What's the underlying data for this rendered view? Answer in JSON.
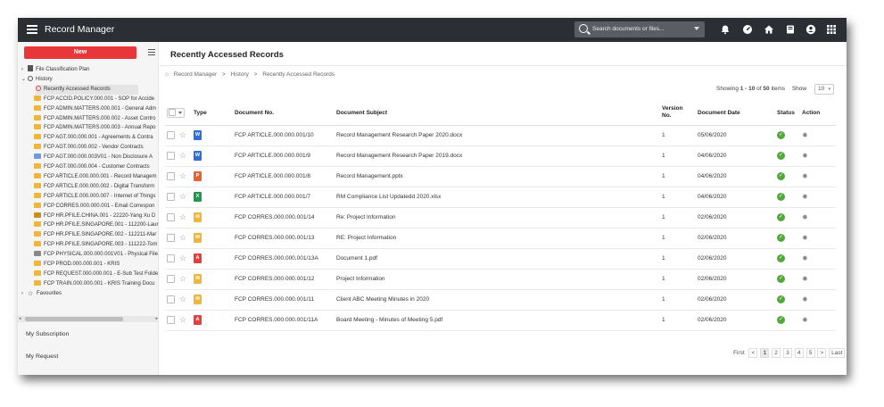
{
  "app": {
    "title": "Record Manager"
  },
  "search": {
    "placeholder": "Search documents or files..."
  },
  "topbar_icons": [
    "bell-icon",
    "dashboard-icon",
    "home-icon",
    "inbox-icon",
    "user-icon",
    "apps-grid-icon"
  ],
  "sidebar": {
    "new_label": "New",
    "tree": [
      {
        "label": "File Classification Plan",
        "icon": "cabinet",
        "caret": "›",
        "indent": 0
      },
      {
        "label": "History",
        "icon": "history",
        "caret": "⌄",
        "indent": 0
      },
      {
        "label": "Recently Accessed Records",
        "icon": "clock",
        "caret": "",
        "indent": 1,
        "selected": true
      },
      {
        "label": "FCP ACCID.POLICY.000.001 - SOP for Accide",
        "icon": "folder",
        "indent": 2
      },
      {
        "label": "FCP ADMIN.MATTERS.000.001 - General Adm",
        "icon": "folder",
        "indent": 2
      },
      {
        "label": "FCP ADMIN.MATTERS.000.002 - Asset Contro",
        "icon": "folder",
        "indent": 2
      },
      {
        "label": "FCP ADMIN.MATTERS.000.003 - Annual Repo",
        "icon": "folder",
        "indent": 2
      },
      {
        "label": "FCP AGT.000.000.001 - Agreements & Contra",
        "icon": "folder",
        "indent": 2
      },
      {
        "label": "FCP AGT.000.000.002 - Vendor Contracts",
        "icon": "folder",
        "indent": 2
      },
      {
        "label": "FCP AGT.000.000.003V01 - Non Disclosure A",
        "icon": "folder-blue",
        "indent": 2
      },
      {
        "label": "FCP AGT.000.000.004 - Customer Contracts",
        "icon": "folder",
        "indent": 2
      },
      {
        "label": "FCP ARTICLE.000.000.001 - Record Managem",
        "icon": "folder",
        "indent": 2
      },
      {
        "label": "FCP ARTICLE.000.000.002 - Digital Transform",
        "icon": "folder",
        "indent": 2
      },
      {
        "label": "FCP ARTICLE.000.000.007 - Internet of Things",
        "icon": "folder",
        "indent": 2
      },
      {
        "label": "FCP CORRES.000.000.001 - Email Correspon",
        "icon": "folder",
        "indent": 2
      },
      {
        "label": "FCP HR.PFILE.CHINA.001 - 22220-Yang Xu D",
        "icon": "folder-person",
        "indent": 2
      },
      {
        "label": "FCP HR.PFILE.SINGAPORE.001 - 112200-Laur",
        "icon": "folder",
        "indent": 2
      },
      {
        "label": "FCP HR.PFILE.SINGAPORE.002 - 112211-Mar",
        "icon": "folder",
        "indent": 2
      },
      {
        "label": "FCP HR.PFILE.SINGAPORE.003 - 111222-Tom",
        "icon": "folder",
        "indent": 2
      },
      {
        "label": "FCP PHYSICAL.000.000.001V01 - Physical File",
        "icon": "folder-grey",
        "indent": 2
      },
      {
        "label": "FCP PROD.000.000.001 - KRIS",
        "icon": "folder",
        "indent": 2
      },
      {
        "label": "FCP REQUEST.000.000.001 - E-Sub Test Folde",
        "icon": "folder",
        "indent": 2
      },
      {
        "label": "FCP TRAIN.000.000.001 - KRIS Training Docu",
        "icon": "folder",
        "indent": 2
      },
      {
        "label": "Favourites",
        "icon": "star",
        "caret": "›",
        "indent": 0
      }
    ],
    "my_subscription": "My Subscription",
    "my_request": "My Request"
  },
  "main": {
    "title": "Recently Accessed Records",
    "breadcrumb": [
      "Record Manager",
      ">",
      "History",
      ">",
      "Recently Accessed Records"
    ],
    "showing_prefix": "Showing ",
    "showing_range": "1 - 10",
    "showing_of": " of ",
    "showing_total": "50",
    "showing_suffix": " items",
    "show_label": "Show",
    "show_value": "10",
    "columns": {
      "type": "Type",
      "docno": "Document No.",
      "subject": "Document Subject",
      "version_line1": "Version",
      "version_line2": "No.",
      "date": "Document Date",
      "status": "Status",
      "action": "Action"
    },
    "rows": [
      {
        "type": "word",
        "docno": "FCP ARTICLE.000.000.001/10",
        "subject": "Record Management Research Paper 2020.docx",
        "version": "1",
        "date": "05/06/2020"
      },
      {
        "type": "word",
        "docno": "FCP ARTICLE.000.000.001/9",
        "subject": "Record Management Research Paper 2019.docx",
        "version": "1",
        "date": "04/06/2020"
      },
      {
        "type": "powerpoint",
        "docno": "FCP ARTICLE.000.000.001/8",
        "subject": "Record Management.pptx",
        "version": "1",
        "date": "04/06/2020"
      },
      {
        "type": "excel",
        "docno": "FCP ARTICLE.000.000.001/7",
        "subject": "RM Compliance List Updatedd 2020.xlsx",
        "version": "1",
        "date": "04/06/2020"
      },
      {
        "type": "email",
        "docno": "FCP CORRES.000.000.001/14",
        "subject": "Re: Project Information",
        "version": "1",
        "date": "02/06/2020"
      },
      {
        "type": "email",
        "docno": "FCP CORRES.000.000.001/13",
        "subject": "RE: Project Information",
        "version": "1",
        "date": "02/06/2020"
      },
      {
        "type": "pdf",
        "docno": "FCP CORRES.000.000.001/13A",
        "subject": "Document 1.pdf",
        "version": "1",
        "date": "02/06/2020"
      },
      {
        "type": "email",
        "docno": "FCP CORRES.000.000.001/12",
        "subject": "Project Information",
        "version": "1",
        "date": "02/06/2020"
      },
      {
        "type": "email",
        "docno": "FCP CORRES.000.000.001/11",
        "subject": "Client ABC Meeting Minutes in 2020",
        "version": "1",
        "date": "02/06/2020"
      },
      {
        "type": "pdf",
        "docno": "FCP CORRES.000.000.001/11A",
        "subject": "Board Meeting - Minutes of Meeting 5.pdf",
        "version": "1",
        "date": "02/06/2020"
      }
    ],
    "type_colors": {
      "word": "#2f6fd6",
      "powerpoint": "#e5632f",
      "excel": "#1f9a4a",
      "email": "#f0b63a",
      "pdf": "#e5403b"
    },
    "type_glyphs": {
      "word": "W",
      "powerpoint": "P",
      "excel": "X",
      "email": "✉",
      "pdf": "A"
    },
    "pager": {
      "first": "First",
      "prev": "<",
      "pages": [
        "1",
        "2",
        "3",
        "4",
        "5"
      ],
      "next": ">",
      "last": "Last",
      "current": "1"
    }
  }
}
